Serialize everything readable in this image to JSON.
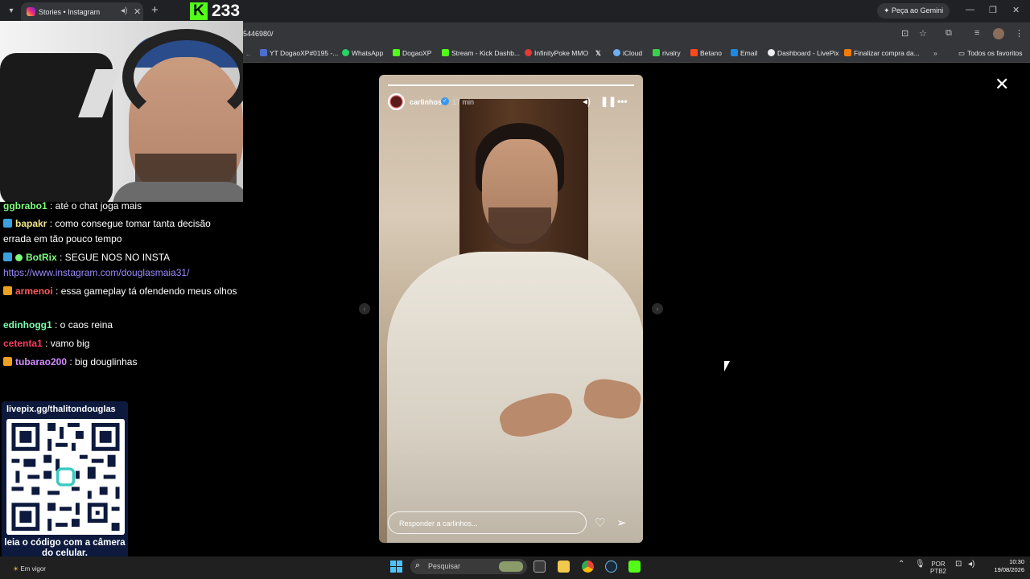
{
  "browser": {
    "tab_title": "Stories • Instagram",
    "url": "5446980/",
    "gemini_label": "Peça ao Gemini",
    "bookmarks": [
      "YT DogaoXP#0195 -...",
      "WhatsApp",
      "DogaoXP",
      "Stream - Kick Dashb...",
      "InfinityPoke MMO",
      "",
      "iCloud",
      "rivalry",
      "Betano",
      "Email",
      "Dashboard - LivePix",
      "Finalizar compra da..."
    ],
    "all_favorites": "Todos os favoritos"
  },
  "stream": {
    "viewer_count": "233",
    "chat": [
      {
        "user": "ggbrabo1",
        "text": ": até o chat joga mais",
        "user_color": "#7dff7d",
        "badge": ""
      },
      {
        "user": "bapakr",
        "text": ": como consegue tomar tanta decisão errada em tão pouco tempo",
        "user_color": "#f0e68c",
        "badge": "bot"
      },
      {
        "user": "BotRix",
        "text": ": SEGUE NOS NO INSTA",
        "user_color": "#7dff7d",
        "badge": "bot"
      },
      {
        "user": "",
        "text": "https://www.instagram.com/douglasmaia31/",
        "user_color": "",
        "badge": ""
      },
      {
        "user": "armenoi",
        "text": ": essa gameplay tá ofendendo meus olhos",
        "user_color": "#ff5a5a",
        "badge": "sub"
      },
      {
        "user": "edinhogg1",
        "text": ": o caos reina",
        "user_color": "#7dffb0",
        "badge": ""
      },
      {
        "user": "cetenta1",
        "text": ": vamo big",
        "user_color": "#ff3b5c",
        "badge": ""
      },
      {
        "user": "tubarao200",
        "text": ": big douglinhas",
        "user_color": "#d28cff",
        "badge": "sub"
      }
    ],
    "qr_url": "livepix.gg/thalitondouglas",
    "qr_caption": "leia o código com a câmera do celular."
  },
  "story": {
    "username": "carlinhos",
    "time": "17 min",
    "reply_placeholder": "Responder a carlinhos..."
  },
  "taskbar": {
    "weather": "Em vigor",
    "search_placeholder": "Pesquisar",
    "lang": "POR",
    "layout": "PTB2",
    "time": "10:30",
    "date": "19/08/2026"
  },
  "colors": {
    "kick_green": "#53fc18",
    "instagram_verified": "#3897f0",
    "link": "#9b8cff"
  }
}
